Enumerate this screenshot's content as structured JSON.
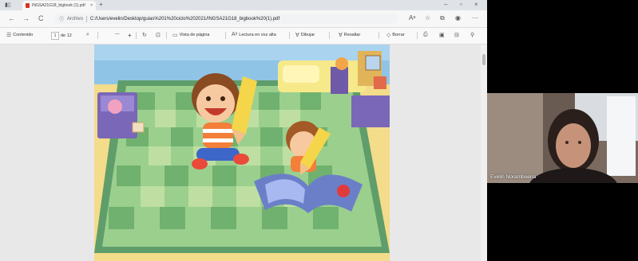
{
  "browser": {
    "tab": {
      "title": "INGSA21G18_bigbook (1).pdf",
      "close": "×",
      "new_tab": "+"
    },
    "window_controls": {
      "minimize": "–",
      "maximize": "▫",
      "close": "×"
    },
    "address": {
      "archivo_label": "Archivo",
      "url": "C:/Users/evelin/Desktop/guias%201%20ciclo%202021/INGSA21G18_bigbook%20(1).pdf"
    },
    "nav": {
      "back": "←",
      "forward": "→",
      "reload": "C",
      "info": "ⓘ"
    }
  },
  "pdf_toolbar": {
    "contents_label": "Contenido",
    "page_current": "1",
    "page_total_label": "de 12",
    "zoom_out": "—",
    "zoom_in": "+",
    "page_view_label": "Vista de página",
    "read_aloud_label": "Lectura en voz alta",
    "draw_label": "Dibujar",
    "highlight_label": "Resaltar",
    "erase_label": "Borrar"
  },
  "participant": {
    "name": "Evelin Norambuena"
  }
}
